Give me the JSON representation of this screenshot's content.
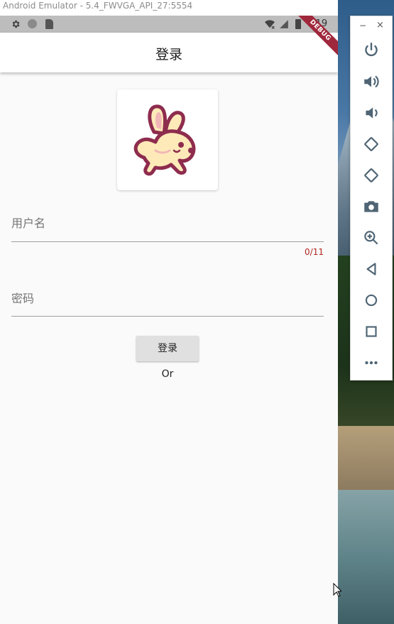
{
  "emulator": {
    "title": "Android Emulator - 5.4_FWVGA_API_27:5554",
    "panel": {
      "minimize_label": "−",
      "close_label": "×",
      "buttons": [
        {
          "icon": "power-icon"
        },
        {
          "icon": "volume-up-icon"
        },
        {
          "icon": "volume-down-icon"
        },
        {
          "icon": "rotate-left-icon"
        },
        {
          "icon": "rotate-right-icon"
        },
        {
          "icon": "camera-icon"
        },
        {
          "icon": "zoom-icon"
        },
        {
          "icon": "back-icon"
        },
        {
          "icon": "home-icon"
        },
        {
          "icon": "overview-icon"
        },
        {
          "icon": "more-icon"
        }
      ]
    }
  },
  "status_bar": {
    "time": "6:19",
    "icons": [
      "settings-icon",
      "circle-icon",
      "sd-card-icon",
      "wifi-icon",
      "signal-icon",
      "battery-icon"
    ]
  },
  "debug_banner": "DEBUG",
  "app_bar": {
    "title": "登录"
  },
  "form": {
    "username_label": "用户名",
    "username_counter": "0/11",
    "password_label": "密码",
    "login_button": "登录",
    "or_text": "Or"
  },
  "colors": {
    "app_background": "#fafafa",
    "counter_color": "#b3261e",
    "debug_banner": "#a0283c",
    "logo_body": "#fdeab8",
    "logo_outline": "#8e2c4e"
  }
}
